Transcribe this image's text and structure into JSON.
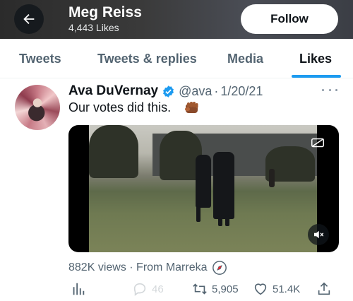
{
  "header": {
    "name": "Meg Reiss",
    "likes_count": "4,443 Likes",
    "follow_label": "Follow"
  },
  "tabs": [
    {
      "label": "Tweets",
      "active": false
    },
    {
      "label": "Tweets & replies",
      "active": false
    },
    {
      "label": "Media",
      "active": false
    },
    {
      "label": "Likes",
      "active": true
    }
  ],
  "colors": {
    "accent": "#1d9bf0",
    "text": "#0f1419",
    "secondary": "#536471"
  },
  "tweet": {
    "author_name": "Ava DuVernay",
    "handle": "@ava",
    "separator": "·",
    "date": "1/20/21",
    "text": "Our votes did this.",
    "emoji_icon": "raised-fist-icon",
    "views": "882K views · From Marreka",
    "source_icon": "compass-icon",
    "reply_count": "46",
    "retweet_count": "5,905",
    "like_count": "51.4K"
  }
}
